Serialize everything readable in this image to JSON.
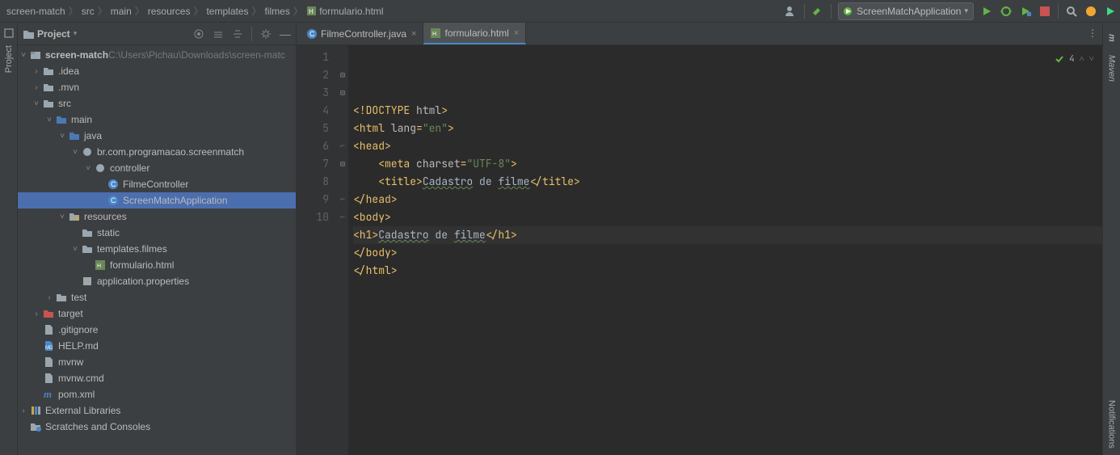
{
  "breadcrumb": [
    "screen-match",
    "src",
    "main",
    "resources",
    "templates",
    "filmes",
    "formulario.html"
  ],
  "runConfig": "ScreenMatchApplication",
  "sidebars": {
    "left": "Project",
    "rightTop": "m",
    "rightMaven": "Maven",
    "rightNotif": "Notifications"
  },
  "projectPanel": {
    "title": "Project",
    "rootHint": "C:\\Users\\Pichau\\Downloads\\screen-matc"
  },
  "tree": [
    {
      "depth": 0,
      "arrow": "down",
      "icon": "module",
      "label": "screen-match",
      "hint": "C:\\Users\\Pichau\\Downloads\\screen-matc",
      "bold": true
    },
    {
      "depth": 1,
      "arrow": "right",
      "icon": "folder",
      "label": ".idea"
    },
    {
      "depth": 1,
      "arrow": "right",
      "icon": "folder",
      "label": ".mvn"
    },
    {
      "depth": 1,
      "arrow": "down",
      "icon": "folder",
      "label": "src"
    },
    {
      "depth": 2,
      "arrow": "down",
      "icon": "folder-src",
      "label": "main"
    },
    {
      "depth": 3,
      "arrow": "down",
      "icon": "folder-src",
      "label": "java"
    },
    {
      "depth": 4,
      "arrow": "down",
      "icon": "package",
      "label": "br.com.programacao.screenmatch"
    },
    {
      "depth": 5,
      "arrow": "down",
      "icon": "package",
      "label": "controller"
    },
    {
      "depth": 6,
      "arrow": "",
      "icon": "class",
      "label": "FilmeController"
    },
    {
      "depth": 6,
      "arrow": "",
      "icon": "class",
      "label": "ScreenMatchApplication",
      "selected": true
    },
    {
      "depth": 3,
      "arrow": "down",
      "icon": "folder-res",
      "label": "resources"
    },
    {
      "depth": 4,
      "arrow": "",
      "icon": "folder",
      "label": "static"
    },
    {
      "depth": 4,
      "arrow": "down",
      "icon": "folder",
      "label": "templates.filmes"
    },
    {
      "depth": 5,
      "arrow": "",
      "icon": "html",
      "label": "formulario.html"
    },
    {
      "depth": 4,
      "arrow": "",
      "icon": "props",
      "label": "application.properties"
    },
    {
      "depth": 2,
      "arrow": "right",
      "icon": "folder",
      "label": "test"
    },
    {
      "depth": 1,
      "arrow": "right",
      "icon": "folder-excl",
      "label": "target"
    },
    {
      "depth": 1,
      "arrow": "",
      "icon": "file",
      "label": ".gitignore"
    },
    {
      "depth": 1,
      "arrow": "",
      "icon": "md",
      "label": "HELP.md"
    },
    {
      "depth": 1,
      "arrow": "",
      "icon": "file",
      "label": "mvnw"
    },
    {
      "depth": 1,
      "arrow": "",
      "icon": "file",
      "label": "mvnw.cmd"
    },
    {
      "depth": 1,
      "arrow": "",
      "icon": "maven",
      "label": "pom.xml"
    },
    {
      "depth": 0,
      "arrow": "right",
      "icon": "lib",
      "label": "External Libraries"
    },
    {
      "depth": 0,
      "arrow": "",
      "icon": "scratch",
      "label": "Scratches and Consoles"
    }
  ],
  "tabs": [
    {
      "icon": "class",
      "label": "FilmeController.java",
      "active": false
    },
    {
      "icon": "html",
      "label": "formulario.html",
      "active": true
    }
  ],
  "inspection": {
    "count": "4"
  },
  "code": {
    "lines": [
      {
        "n": 1,
        "html": "<span class='tok-tag'>&lt;!DOCTYPE <span class='tok-attr'>html</span>&gt;</span>"
      },
      {
        "n": 2,
        "html": "<span class='tok-tag'>&lt;html <span class='tok-attr'>lang</span>=<span class='tok-str'>\"en\"</span>&gt;</span>",
        "fold": true
      },
      {
        "n": 3,
        "html": "<span class='tok-tag'>&lt;head&gt;</span>",
        "fold": true
      },
      {
        "n": 4,
        "html": "    <span class='tok-tag'>&lt;meta <span class='tok-attr'>charset</span>=<span class='tok-str'>\"UTF-8\"</span>&gt;</span>"
      },
      {
        "n": 5,
        "html": "    <span class='tok-tag'>&lt;title&gt;</span><span class='tok-text underline-wavy'>Cadastro</span><span class='tok-text'> de </span><span class='tok-text underline-wavy'>filme</span><span class='tok-tag'>&lt;/title&gt;</span>"
      },
      {
        "n": 6,
        "html": "<span class='tok-tag'>&lt;/head&gt;</span>",
        "foldEnd": true
      },
      {
        "n": 7,
        "html": "<span class='tok-tag'>&lt;body&gt;</span>",
        "fold": true
      },
      {
        "n": 8,
        "html": "<span class='tok-tag'>&lt;h1&gt;</span><span class='tok-text underline-wavy'>Cadastro</span><span class='tok-text'> de </span><span class='tok-text underline-wavy'>filme</span><span class='tok-tag'>&lt;/h1&gt;</span>",
        "highlight": true
      },
      {
        "n": 9,
        "html": "<span class='tok-tag'>&lt;/body&gt;</span>",
        "foldEnd": true
      },
      {
        "n": 10,
        "html": "<span class='tok-tag'>&lt;/html&gt;</span>",
        "foldEnd": true
      }
    ]
  }
}
